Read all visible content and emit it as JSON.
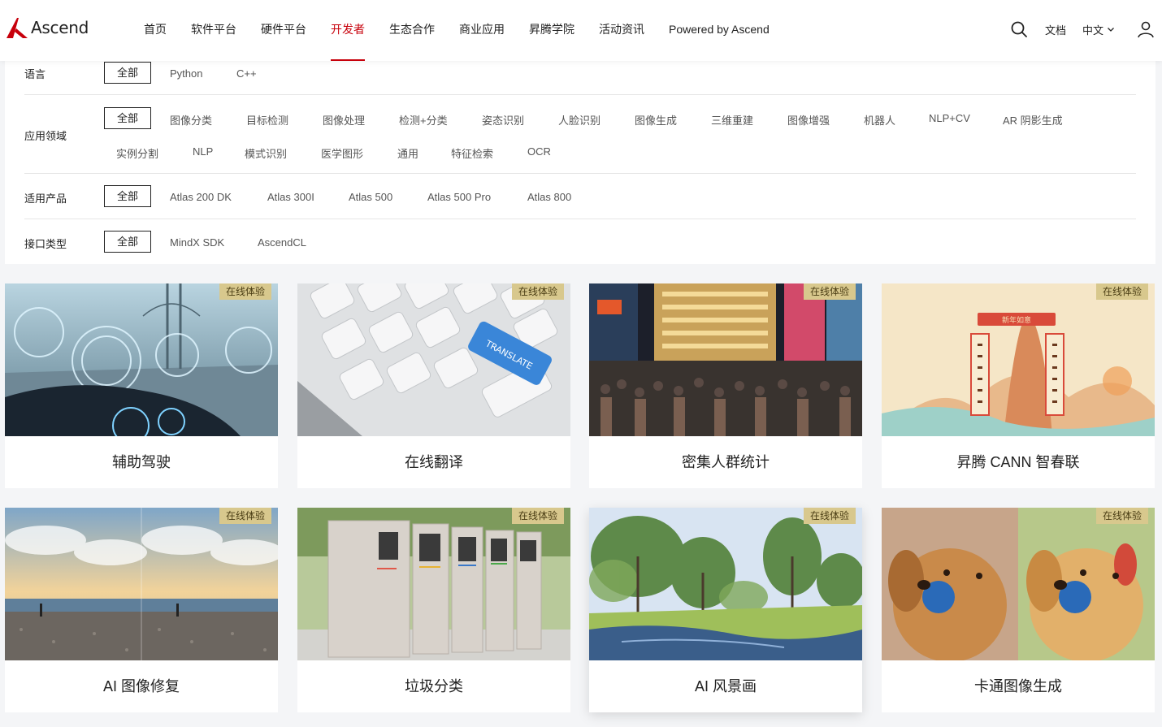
{
  "brand": {
    "logo_text": "Ascend",
    "accent": "#c7000b"
  },
  "nav": {
    "items": [
      {
        "label": "首页",
        "active": false
      },
      {
        "label": "软件平台",
        "active": false
      },
      {
        "label": "硬件平台",
        "active": false
      },
      {
        "label": "开发者",
        "active": true
      },
      {
        "label": "生态合作",
        "active": false
      },
      {
        "label": "商业应用",
        "active": false
      },
      {
        "label": "昇腾学院",
        "active": false
      },
      {
        "label": "活动资讯",
        "active": false
      },
      {
        "label": "Powered by Ascend",
        "active": false
      }
    ]
  },
  "header_right": {
    "search_icon": "search-icon",
    "docs_label": "文档",
    "language": "中文",
    "user_icon": "user-icon"
  },
  "filters": {
    "language": {
      "label": "语言",
      "options": [
        "全部",
        "Python",
        "C++"
      ],
      "selected": "全部"
    },
    "domain": {
      "label": "应用领域",
      "options_row1": [
        "全部",
        "图像分类",
        "目标检测",
        "图像处理",
        "检测+分类",
        "姿态识别",
        "人脸识别",
        "图像生成",
        "三维重建",
        "图像增强",
        "机器人",
        "NLP+CV",
        "AR 阴影生成"
      ],
      "options_row2": [
        "实例分割",
        "NLP",
        "模式识别",
        "医学图形",
        "通用",
        "特征检索",
        "OCR"
      ],
      "selected": "全部"
    },
    "product": {
      "label": "适用产品",
      "options": [
        "全部",
        "Atlas 200 DK",
        "Atlas 300I",
        "Atlas 500",
        "Atlas 500 Pro",
        "Atlas 800"
      ],
      "selected": "全部"
    },
    "interface": {
      "label": "接口类型",
      "options": [
        "全部",
        "MindX SDK",
        "AscendCL"
      ],
      "selected": "全部"
    }
  },
  "cards": [
    {
      "title": "辅助驾驶",
      "badge": "在线体验"
    },
    {
      "title": "在线翻译",
      "badge": "在线体验"
    },
    {
      "title": "密集人群统计",
      "badge": "在线体验"
    },
    {
      "title": "昇腾 CANN 智春联",
      "badge": "在线体验"
    },
    {
      "title": "AI 图像修复",
      "badge": "在线体验"
    },
    {
      "title": "垃圾分类",
      "badge": "在线体验"
    },
    {
      "title": "AI 风景画",
      "badge": "在线体验"
    },
    {
      "title": "卡通图像生成",
      "badge": "在线体验"
    }
  ],
  "thumbnails": {
    "keyboard_key": "TRANSLATE",
    "couplet_banner": "新年如意"
  }
}
